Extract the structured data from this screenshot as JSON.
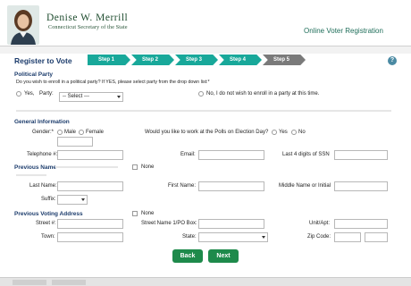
{
  "header": {
    "logo_name": "Denise W. Merrill",
    "logo_title": "Connecticut Secretary of the State",
    "app_title": "Online Voter Registration"
  },
  "page": {
    "title": "Register to Vote",
    "help_label": "?",
    "steps": [
      "Step 1",
      "Step 2",
      "Step 3",
      "Step 4",
      "Step 5"
    ],
    "accent_color": "#18a89a",
    "inactive_step_color": "#7a7a7a"
  },
  "party": {
    "heading": "Political Party",
    "question": "Do you wish to enroll in a political party? If YES, please select party from the drop down list:*",
    "yes_label": "Yes,",
    "party_label": "Party:",
    "select_value": "-- Select ---",
    "no_label": "No, I do not wish to enroll in a party at this time."
  },
  "general": {
    "heading": "General Information",
    "gender_label": "Gender:*",
    "male_label": "Male",
    "female_label": "Female",
    "polls_question": "Would you like to work at the Polls on Election Day?",
    "polls_yes": "Yes",
    "polls_no": "No",
    "telephone_label": "Telephone #:",
    "email_label": "Email:",
    "ssn_label": "Last 4 digits of SSN"
  },
  "previous_name": {
    "heading": "Previous Name",
    "none_label": "None",
    "last_name_label": "Last Name:",
    "first_name_label": "First Name:",
    "middle_label": "Middle Name or Initial",
    "suffix_label": "Suffix:"
  },
  "previous_address": {
    "heading": "Previous Voting Address",
    "none_label": "None",
    "street_label": "Street #:",
    "street_name_label": "Street Name 1/PO Box:",
    "unit_label": "Unit/Apt:",
    "town_label": "Town:",
    "state_label": "State:",
    "zip_label": "Zip Code:"
  },
  "buttons": {
    "back": "Back",
    "next": "Next",
    "button_color": "#1e8a4b"
  }
}
